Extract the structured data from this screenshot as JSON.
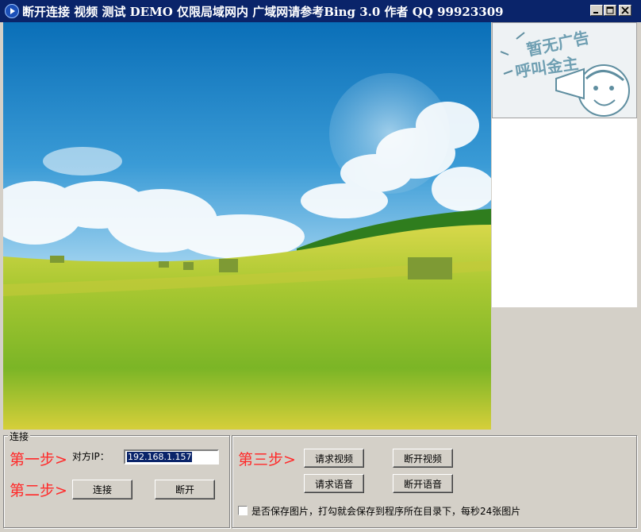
{
  "window": {
    "title": "断开连接 视频 测试 DEMO 仅限局域网内 广域网请参考Bing 3.0 作者 QQ 99923309"
  },
  "ad": {
    "text_top": "暂无广告",
    "text_bottom": "呼叫金主"
  },
  "connect_group": {
    "label": "连接",
    "step1": "第一步>",
    "ip_label": "对方IP：",
    "ip_value": "192.168.1.157",
    "step2": "第二步>",
    "connect_button": "连接",
    "disconnect_button": "断开"
  },
  "media_group": {
    "step3": "第三步>",
    "request_video": "请求视频",
    "disconnect_video": "断开视频",
    "request_audio": "请求语音",
    "disconnect_audio": "断开语音",
    "save_checkbox_label": "是否保存图片，打勾就会保存到程序所在目录下，每秒24张图片",
    "save_checked": false
  },
  "colors": {
    "titlebar": "#0a246a",
    "step_text": "#ff2a2a",
    "face": "#d4d0c8"
  }
}
